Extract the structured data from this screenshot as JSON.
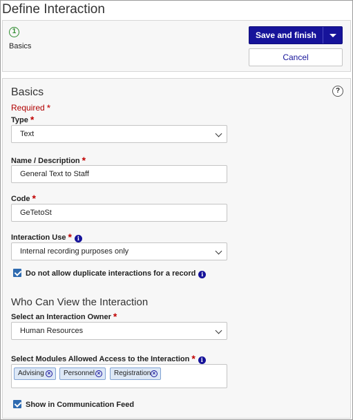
{
  "page": {
    "title": "Define Interaction"
  },
  "wizard": {
    "step_number": "1",
    "step_label": "Basics",
    "save_label": "Save and finish",
    "cancel_label": "Cancel"
  },
  "basics": {
    "title": "Basics",
    "required_note": "Required",
    "help_label": "?",
    "type": {
      "label": "Type",
      "value": "Text"
    },
    "name": {
      "label": "Name / Description",
      "value": "General Text to Staff"
    },
    "code": {
      "label": "Code",
      "value": "GeTetoSt"
    },
    "interaction_use": {
      "label": "Interaction Use",
      "value": "Internal recording purposes only"
    },
    "no_duplicates": {
      "label": "Do not allow duplicate interactions for a record",
      "checked": true
    }
  },
  "view": {
    "title": "Who Can View the Interaction",
    "owner": {
      "label": "Select an Interaction Owner",
      "value": "Human Resources"
    },
    "modules": {
      "label": "Select Modules Allowed Access to the Interaction",
      "chips": [
        "Advising",
        "Personnel",
        "Registration"
      ]
    },
    "feed": {
      "label": "Show in Communication Feed",
      "checked": true
    }
  },
  "colors": {
    "primary": "#16139a",
    "required": "#c00000",
    "step_green": "#2e8b2e",
    "checkbox": "#2f6bb0",
    "chip_bg": "#dde8f6"
  }
}
